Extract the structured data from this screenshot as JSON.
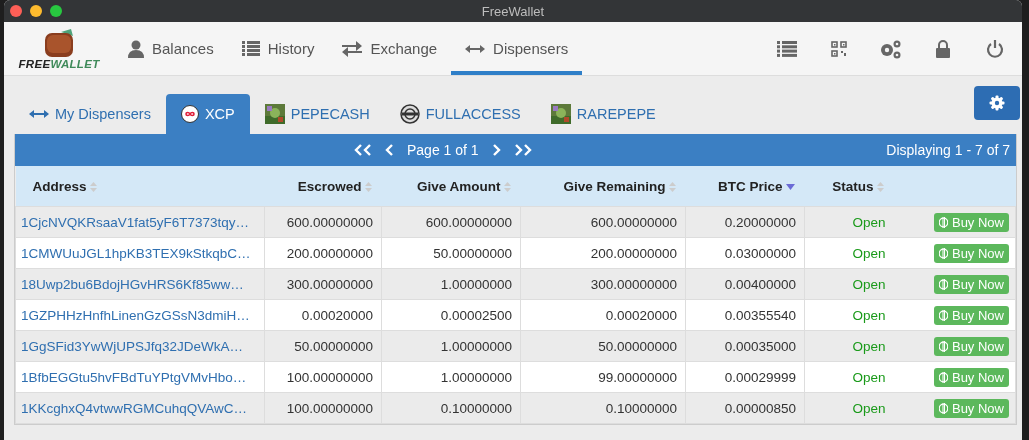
{
  "window": {
    "title": "FreeWallet"
  },
  "logo": {
    "words": [
      "FREE",
      "WALLET"
    ]
  },
  "nav": [
    {
      "label": "Balances",
      "kind": "person",
      "selected": false
    },
    {
      "label": "History",
      "kind": "list",
      "selected": false
    },
    {
      "label": "Exchange",
      "kind": "exchange",
      "selected": false
    },
    {
      "label": "Dispensers",
      "kind": "arrows",
      "selected": true
    }
  ],
  "tabs": [
    {
      "label": "My Dispensers",
      "kind": "arrows",
      "selected": false
    },
    {
      "label": "XCP",
      "kind": "xcp",
      "selected": true
    },
    {
      "label": "PEPECASH",
      "selected": false
    },
    {
      "label": "FULLACCESS",
      "kind": "badge",
      "selected": false
    },
    {
      "label": "RAREPEPE",
      "selected": false
    }
  ],
  "pager": {
    "page": "Page 1 of 1",
    "displaying": "Displaying 1 - 7 of 7"
  },
  "table": {
    "columns": [
      {
        "label": "Address",
        "sorted": false
      },
      {
        "label": "Escrowed",
        "sorted": false
      },
      {
        "label": "Give Amount",
        "sorted": false
      },
      {
        "label": "Give Remaining",
        "sorted": false
      },
      {
        "label": "BTC Price",
        "sorted": true
      },
      {
        "label": "Status",
        "sorted": false
      }
    ],
    "rows": [
      {
        "address": "1CjcNVQKRsaaV1fat5yF6T7373tqy…",
        "escrowed": "600.00000000",
        "give_amount": "600.00000000",
        "give_remaining": "600.00000000",
        "btc_price": "0.20000000",
        "status": "Open",
        "button": "Buy Now"
      },
      {
        "address": "1CMWUuJGL1hpKB3TEX9kStkqbC…",
        "escrowed": "200.00000000",
        "give_amount": "50.00000000",
        "give_remaining": "200.00000000",
        "btc_price": "0.03000000",
        "status": "Open",
        "button": "Buy Now"
      },
      {
        "address": "18Uwp2bu6BdojHGvHRS6Kf85ww…",
        "escrowed": "300.00000000",
        "give_amount": "1.00000000",
        "give_remaining": "300.00000000",
        "btc_price": "0.00400000",
        "status": "Open",
        "button": "Buy Now"
      },
      {
        "address": "1GZPHHzHnfhLinenGzGSsN3dmiH…",
        "escrowed": "0.00020000",
        "give_amount": "0.00002500",
        "give_remaining": "0.00020000",
        "btc_price": "0.00355540",
        "status": "Open",
        "button": "Buy Now"
      },
      {
        "address": "1GgSFid3YwWjUPSJfq32JDeWkA…",
        "escrowed": "50.00000000",
        "give_amount": "1.00000000",
        "give_remaining": "50.00000000",
        "btc_price": "0.00035000",
        "status": "Open",
        "button": "Buy Now"
      },
      {
        "address": "1BfbEGGtu5hvFBdTuYPtgVMvHbo…",
        "escrowed": "100.00000000",
        "give_amount": "1.00000000",
        "give_remaining": "99.00000000",
        "btc_price": "0.00029999",
        "status": "Open",
        "button": "Buy Now"
      },
      {
        "address": "1KKcghxQ4vtwwRGMCuhqQVAwC…",
        "escrowed": "100.00000000",
        "give_amount": "0.10000000",
        "give_remaining": "0.10000000",
        "btc_price": "0.00000850",
        "status": "Open",
        "button": "Buy Now"
      }
    ]
  }
}
